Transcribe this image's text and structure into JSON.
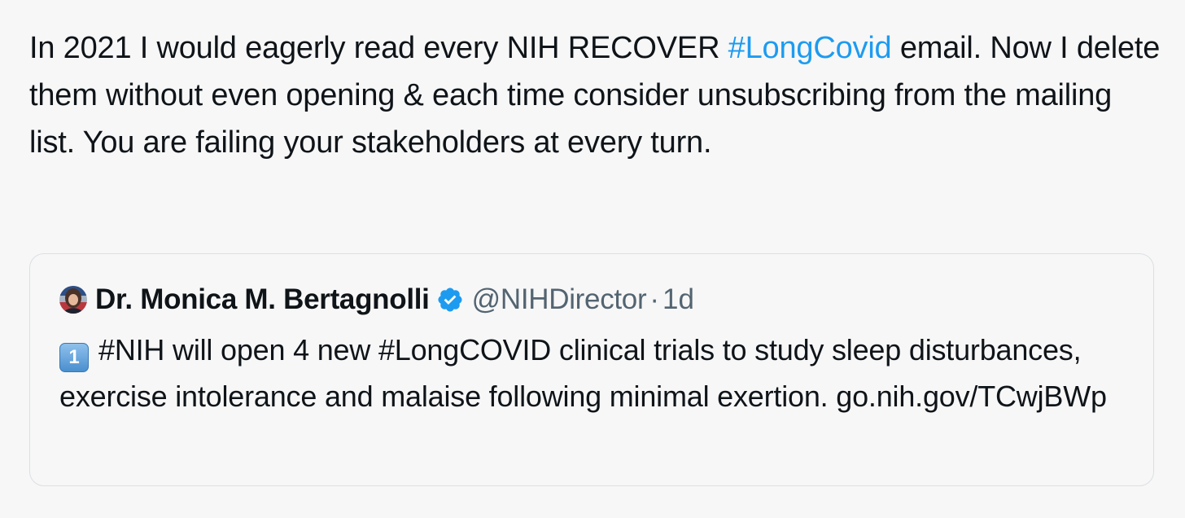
{
  "tweet": {
    "text_before": "In 2021 I would eagerly read every NIH RECOVER ",
    "hashtag": "#LongCovid",
    "text_after": " email. Now I delete them without even opening & each time consider unsubscribing from the mailing list. You are failing your stakeholders at every turn."
  },
  "quote": {
    "author_name": "Dr. Monica M. Bertagnolli",
    "handle": "@NIHDirector",
    "separator": "·",
    "time": "1d",
    "keycap": "1",
    "body": "#NIH will open 4 new #LongCOVID clinical trials to study sleep disturbances, exercise intolerance and malaise following minimal exertion. go.nih.gov/TCwjBWp",
    "avatar_icon": "avatar-icon",
    "verified_icon": "verified-badge-icon"
  },
  "colors": {
    "background": "#f7f7f7",
    "text": "#0f1419",
    "hashtag": "#1d9bf0",
    "secondary": "#536471",
    "card_border": "#dcdfe2",
    "verified": "#1d9bf0"
  }
}
